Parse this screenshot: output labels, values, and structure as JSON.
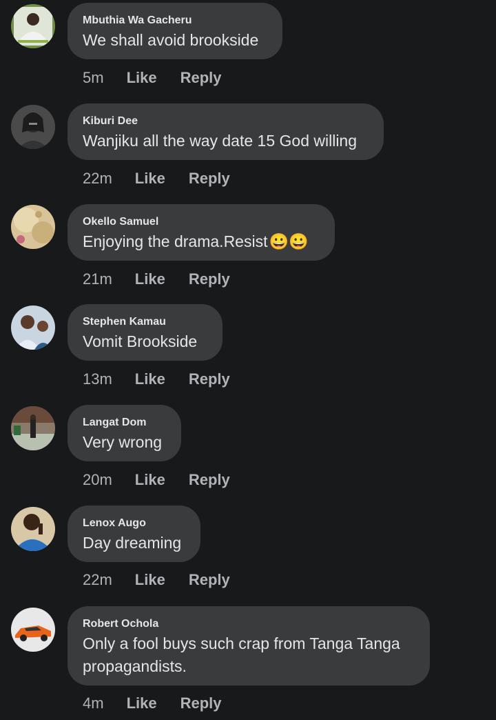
{
  "comments": [
    {
      "author": "Mbuthia Wa Gacheru",
      "text": "We shall avoid brookside",
      "time": "5m",
      "like": "Like",
      "reply": "Reply"
    },
    {
      "author": "Kiburi Dee",
      "text": "Wanjiku all the way date 15 God willing",
      "time": "22m",
      "like": "Like",
      "reply": "Reply"
    },
    {
      "author": "Okello Samuel",
      "text": "Enjoying the drama.Resist",
      "emoji": "😀😀",
      "time": "21m",
      "like": "Like",
      "reply": "Reply"
    },
    {
      "author": "Stephen Kamau",
      "text": "Vomit Brookside",
      "time": "13m",
      "like": "Like",
      "reply": "Reply"
    },
    {
      "author": "Langat Dom",
      "text": "Very wrong",
      "time": "20m",
      "like": "Like",
      "reply": "Reply"
    },
    {
      "author": "Lenox Augo",
      "text": "Day dreaming",
      "time": "22m",
      "like": "Like",
      "reply": "Reply"
    },
    {
      "author": "Robert Ochola",
      "text_line1": "Only a fool buys such crap from Tanga Tanga",
      "text_line2": "propagandists.",
      "time": "4m",
      "like": "Like",
      "reply": "Reply"
    }
  ]
}
